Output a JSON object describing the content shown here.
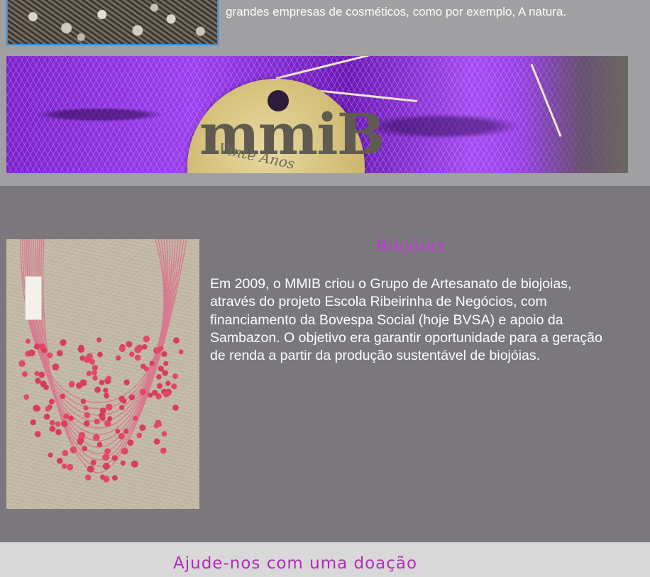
{
  "intro": {
    "text": "grandes empresas de cosméticos, como por exemplo, A natura."
  },
  "banner": {
    "tag_logo": "mmiB",
    "tag_subtitle": "Vinte Anos"
  },
  "biojoias": {
    "title": "Biojóias",
    "body": "Em 2009, o MMIB criou o Grupo de Artesanato de biojoias, através do projeto Escola Ribeirinha de Negócios, com financiamento da Bovespa Social (hoje BVSA) e apoio da Sambazon. O objetivo era garantir oportunidade para a geração de renda a partir da produção sustentável de biojóias."
  },
  "donate": {
    "title": "Ajude-nos com uma doação"
  },
  "colors": {
    "accent": "#c23ad6",
    "section_bg": "#7a787d",
    "top_bg": "#a09fa2",
    "footer_bg": "#d9d8d9"
  }
}
